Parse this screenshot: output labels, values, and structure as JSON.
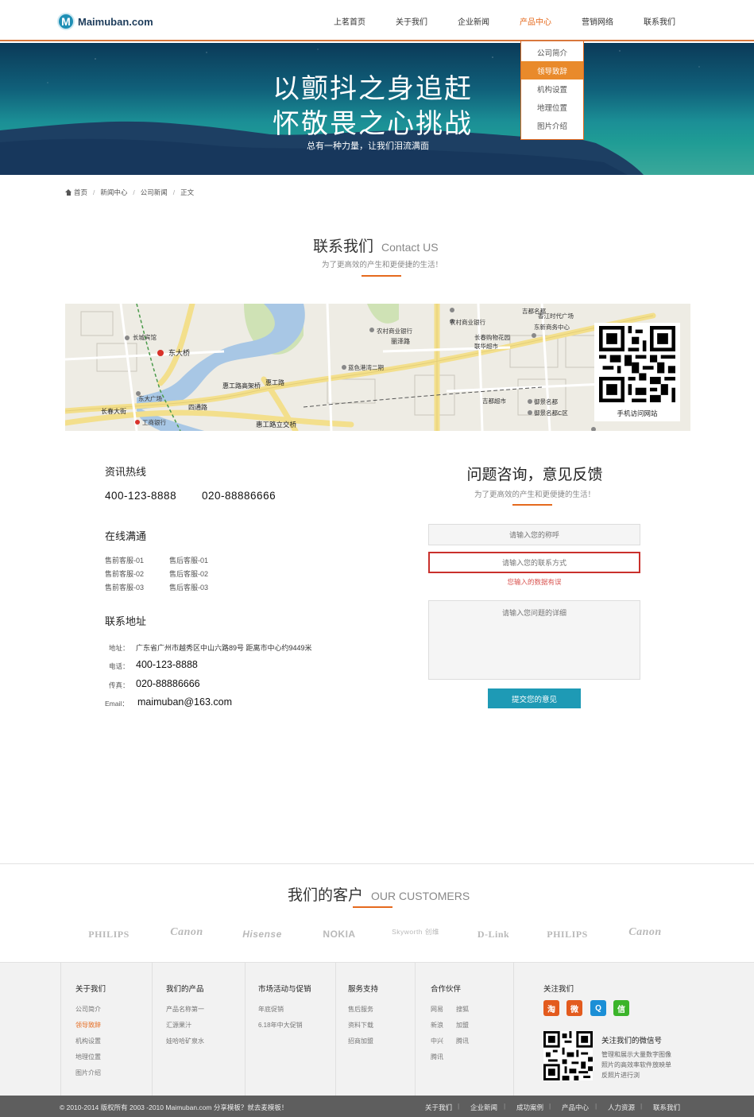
{
  "header": {
    "logo_letter": "M",
    "logo_text": "Maimuban.com",
    "nav": [
      "上茗首页",
      "关于我们",
      "企业新闻",
      "产品中心",
      "营销网络",
      "联系我们"
    ],
    "nav_active_index": 3,
    "dropdown": [
      "公司简介",
      "领导致辞",
      "机构设置",
      "地理位置",
      "图片介绍"
    ],
    "dropdown_active_index": 1
  },
  "banner": {
    "title_line1": "以颤抖之身追赶",
    "title_line2": "怀敬畏之心挑战",
    "subtitle": "总有一种力量，让我们泪流满面"
  },
  "breadcrumb": [
    "首页",
    "新闻中心",
    "公司新闻",
    "正文"
  ],
  "contact_section": {
    "title_cn": "联系我们",
    "title_en": "Contact US",
    "subtitle": "为了更高效的产生和更便捷的生活！"
  },
  "map": {
    "labels": [
      "东大桥",
      "东大广场",
      "长城宾馆",
      "工商银行",
      "惠工路高架桥",
      "惠工路",
      "四通路",
      "惠工路立交桥",
      "蓝色港湾二期",
      "农村商业银行",
      "丽泽路",
      "农村商业银行",
      "香江时代广场",
      "长春购物花园",
      "联华超市",
      "吉都超市",
      "御景名都",
      "御景名都C区",
      "吉都名都",
      "东新商务中心",
      "长春大街"
    ],
    "qr_caption": "手机访问网站",
    "accent": "#f3df8c"
  },
  "contact_info": {
    "hotline_heading": "资讯热线",
    "hotline_1": "400-123-8888",
    "hotline_2": "020-88886666",
    "online_heading": "在线满通",
    "service_left": [
      "售前客服-01",
      "售前客服-02",
      "售前客服-03"
    ],
    "service_right": [
      "售后客服-01",
      "售后客服-02",
      "售后客服-03"
    ],
    "address_heading": "联系地址",
    "address_label": "地址：",
    "address_value": "广东省广州市越秀区中山六路89号  距离市中心约9449米",
    "phone_label": "电话：",
    "phone_value": "400-123-8888",
    "fax_label": "传真：",
    "fax_value": "020-88886666",
    "email_label": "Email：",
    "email_value": "maimuban@163.com"
  },
  "feedback": {
    "title": "问题咨询，意见反馈",
    "subtitle": "为了更高效的产生和更便捷的生活！",
    "name_placeholder": "请输入您的称呼",
    "contact_placeholder": "请输入您的联系方式",
    "error_message": "您输入的数据有误",
    "detail_placeholder": "请输入您问题的详细",
    "submit_label": "提交您的意见",
    "accent": "#1e9ab5",
    "error_color": "#c9302c"
  },
  "customers": {
    "title_cn": "我们的客户",
    "title_en": "OUR CUSTOMERS",
    "logos": [
      "PHILIPS",
      "Canon",
      "Hisense",
      "NOKIA",
      "Skyworth 创维",
      "D-Link",
      "PHILIPS",
      "Canon"
    ]
  },
  "footer": {
    "columns": [
      {
        "heading": "关于我们",
        "links": [
          "公司简介",
          "领导致辞",
          "机构设置",
          "地理位置",
          "图片介绍"
        ],
        "active_index": 1
      },
      {
        "heading": "我们的产品",
        "links": [
          "产品名称第一",
          "汇源果汁",
          "娃哈哈矿泉水"
        ]
      },
      {
        "heading": "市场活动与促销",
        "links": [
          "年底促销",
          "6.18年中大促销"
        ]
      },
      {
        "heading": "服务支持",
        "links": [
          "售后服务",
          "资料下载",
          "招商加盟"
        ]
      },
      {
        "heading": "合作伙伴",
        "links": [
          "网易",
          "搜狐",
          "新浪",
          "加盟",
          "中兴",
          "腾讯",
          "腾讯"
        ]
      }
    ],
    "follow_heading": "关注我们",
    "social_icons": [
      "taobao-icon",
      "weibo-icon",
      "qq-icon",
      "wechat-icon"
    ],
    "social_glyphs": [
      "淘",
      "微",
      "Q",
      "信"
    ],
    "social_colors": [
      "#e35b1e",
      "#e35b1e",
      "#1b8fd6",
      "#3bb42a"
    ],
    "wechat_title": "关注我们的微信号",
    "wechat_desc_1": "管理和展示大量数字图像",
    "wechat_desc_2": "照片的高效率软件放映单",
    "wechat_desc_3": "反照片进行浏"
  },
  "bottom_bar": {
    "copyright": "© 2010-2014 版权所有 2003 -2010 Maimuban.com  分享模板？就去麦模板！",
    "links": [
      "关于我们",
      "企业新闻",
      "成功案例",
      "产品中心",
      "人力资源",
      "联系我们"
    ]
  }
}
